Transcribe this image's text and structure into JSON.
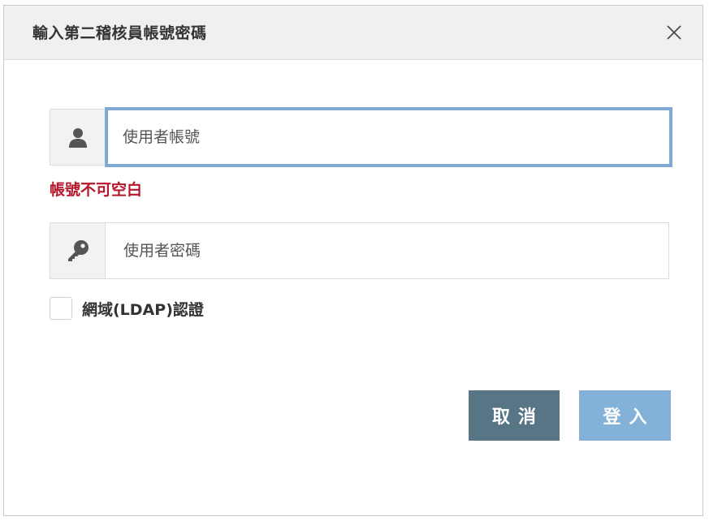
{
  "dialog": {
    "title": "輸入第二稽核員帳號密碼",
    "close_icon": "close-icon"
  },
  "username": {
    "placeholder": "使用者帳號",
    "icon": "user-icon",
    "error": "帳號不可空白"
  },
  "password": {
    "placeholder": "使用者密碼",
    "icon": "key-icon"
  },
  "ldap": {
    "label": "網域(LDAP)認證",
    "checked": false
  },
  "buttons": {
    "cancel": "取消",
    "login": "登入"
  },
  "colors": {
    "focus_border": "#80aad4",
    "error": "#b5172b",
    "cancel_bg": "#577585",
    "login_bg": "#83b1d8"
  }
}
